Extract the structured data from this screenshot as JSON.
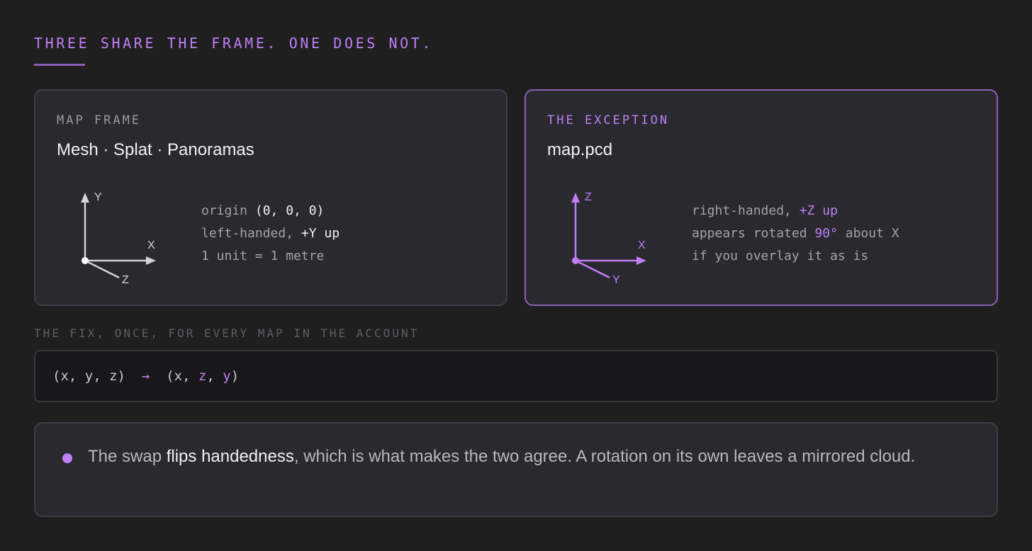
{
  "heading": "THREE SHARE THE FRAME. ONE DOES NOT.",
  "colors": {
    "accent": "#c07ef5",
    "background": "#1f1f20",
    "card": "#2a292f",
    "axis_neutral": "#d4d2d8"
  },
  "map_frame": {
    "eyebrow": "MAP FRAME",
    "title": "Mesh · Splat · Panoramas",
    "axes": {
      "up": "Y",
      "right": "X",
      "diagonal": "Z"
    },
    "notes": {
      "line1_prefix": "origin ",
      "line1_value": "(0, 0, 0)",
      "line2_prefix": "left-handed, ",
      "line2_value": "+Y up",
      "line3": "1 unit = 1 metre"
    }
  },
  "exception": {
    "eyebrow": "THE EXCEPTION",
    "title": "map.pcd",
    "axes": {
      "up": "Z",
      "right": "X",
      "diagonal": "Y"
    },
    "notes": {
      "line1_prefix": "right-handed, ",
      "line1_value": "+Z up",
      "line2_prefix": "appears rotated ",
      "line2_value": "90°",
      "line2_suffix": " about X",
      "line3": "if you overlay it as is"
    }
  },
  "fix": {
    "label": "THE FIX, ONCE, FOR EVERY MAP IN THE ACCOUNT",
    "from": "(x, y, z)",
    "arrow": "→",
    "to_open": "(x, ",
    "to_z": "z",
    "to_sep": ", ",
    "to_y": "y",
    "to_close": ")"
  },
  "note": {
    "prefix": "The swap ",
    "strong": "flips handedness",
    "suffix": ", which is what makes the two agree. A rotation on its own leaves a mirrored cloud."
  }
}
